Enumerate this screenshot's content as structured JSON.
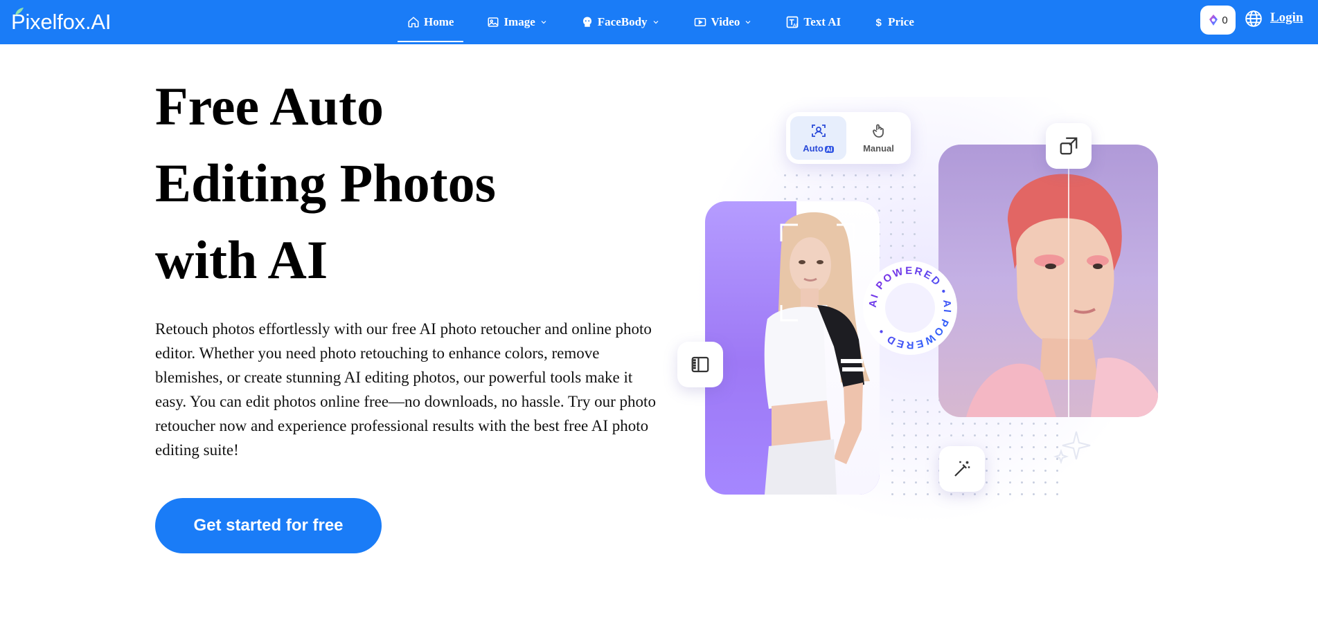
{
  "brand": {
    "name": "Pixelfox.AI"
  },
  "nav": {
    "items": [
      {
        "label": "Home",
        "icon": "home-icon",
        "dropdown": false,
        "active": true
      },
      {
        "label": "Image",
        "icon": "image-icon",
        "dropdown": true,
        "active": false
      },
      {
        "label": "FaceBody",
        "icon": "face-icon",
        "dropdown": true,
        "active": false
      },
      {
        "label": "Video",
        "icon": "video-icon",
        "dropdown": true,
        "active": false
      },
      {
        "label": "Text AI",
        "icon": "text-ai-icon",
        "dropdown": false,
        "active": false
      },
      {
        "label": "Price",
        "icon": "dollar-icon",
        "dropdown": false,
        "active": false
      }
    ],
    "credits": "0",
    "login": "Login"
  },
  "hero": {
    "title_lines": [
      "Free Auto",
      "Editing Photos",
      "with AI"
    ],
    "description": "Retouch photos effortlessly with our free AI photo retoucher and online photo editor. Whether you need photo retouching to enhance colors, remove blemishes, or create stunning AI editing photos, our powerful tools make it easy. You can edit photos online free—no downloads, no hassle. Try our photo retoucher now and experience professional results with the best free AI photo editing suite!",
    "cta": "Get started for free"
  },
  "illustration": {
    "mode_auto": "Auto",
    "mode_auto_badge": "AI",
    "mode_manual": "Manual",
    "ring_text": "AI POWERED • AI POWERED • "
  },
  "colors": {
    "brand_blue": "#1a7cf7",
    "accent_purple": "#a98bff",
    "ring_blue": "#2553e6"
  }
}
